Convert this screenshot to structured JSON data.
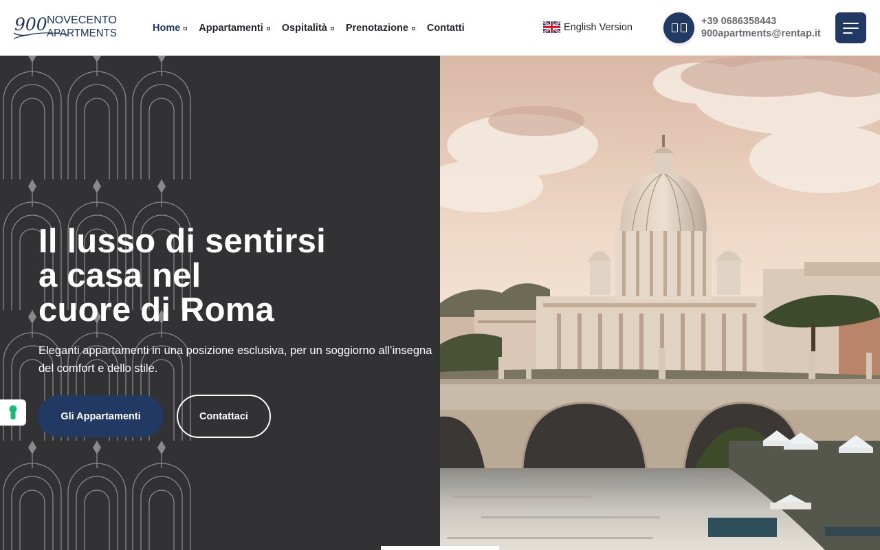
{
  "header": {
    "logo": {
      "number": "900",
      "line1": "NOVECENTO",
      "line2": "APARTMENTS"
    },
    "nav": [
      {
        "label": "Home",
        "has_dropdown": true,
        "active": true
      },
      {
        "label": "Appartamenti",
        "has_dropdown": true,
        "active": false
      },
      {
        "label": "Ospitalità",
        "has_dropdown": true,
        "active": false
      },
      {
        "label": "Prenotazione",
        "has_dropdown": true,
        "active": false
      },
      {
        "label": "Contatti",
        "has_dropdown": false,
        "active": false
      }
    ],
    "language_label": "English Version",
    "language_flag": "uk-flag-icon",
    "contact_icon": "phone-mail-icon",
    "phone": "+39 0686358443",
    "email": "900apartments@rentap.it",
    "menu_icon": "hamburger-icon"
  },
  "hero": {
    "title_lines": [
      "Il lusso di sentirsi",
      "a casa nel",
      "cuore di Roma"
    ],
    "subtitle": "Eleganti appartamenti in una posizione esclusiva, per un soggiorno all’insegna del comfort e dello stile.",
    "primary_button": "Gli Appartamenti",
    "secondary_button": "Contattaci",
    "image_subject": "St. Peter's Basilica and Ponte Sant'Angelo over the Tiber at sunset",
    "side_tab_icon": "keyhole-icon"
  },
  "colors": {
    "brand_navy": "#223a63",
    "dark_panel": "#323234",
    "text_dark": "#26262a",
    "text_gray": "#6b6b6f",
    "white": "#ffffff"
  }
}
